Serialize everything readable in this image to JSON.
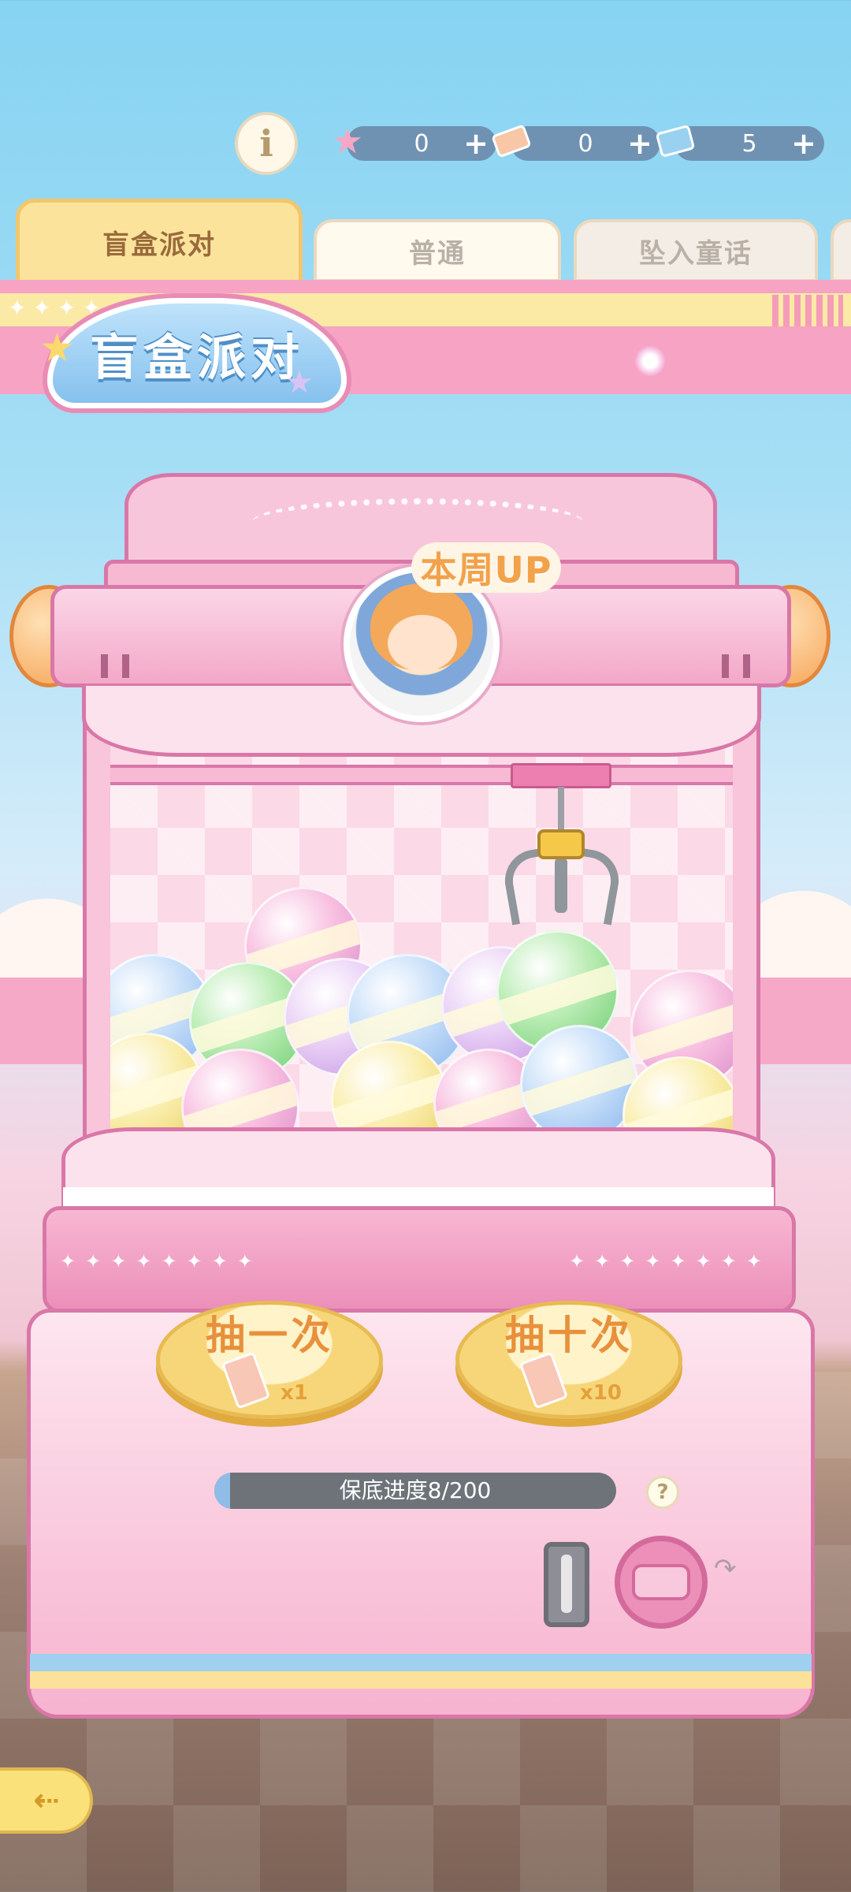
{
  "top_bar": {
    "info_label": "i",
    "currencies": [
      {
        "icon": "star-gem-icon",
        "amount": "0"
      },
      {
        "icon": "pink-ticket-icon",
        "amount": "0"
      },
      {
        "icon": "blue-card-icon",
        "amount": "5"
      }
    ],
    "plus_label": "+"
  },
  "tabs": [
    {
      "label": "盲盒派对",
      "active": true
    },
    {
      "label": "普通",
      "active": false
    },
    {
      "label": "坠入童话",
      "active": false
    }
  ],
  "banner": {
    "logo_text": "盲盒派对"
  },
  "machine": {
    "featured_label": "本周UP"
  },
  "draw_buttons": [
    {
      "label": "抽一次",
      "count": "x1"
    },
    {
      "label": "抽十次",
      "count": "x10"
    }
  ],
  "pity": {
    "text": "保底进度8/200",
    "current": 8,
    "total": 200,
    "help_label": "?"
  },
  "colors": {
    "accent_pink": "#f7a3c4",
    "gold": "#f7d679",
    "sky": "#86d3f2"
  }
}
